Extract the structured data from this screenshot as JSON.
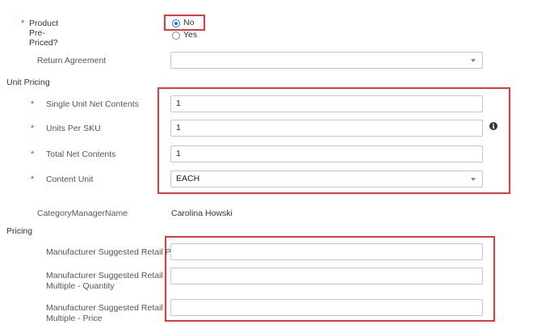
{
  "pre_priced": {
    "label": "Product Pre-Priced?",
    "options": [
      {
        "label": "No",
        "checked": true
      },
      {
        "label": "Yes",
        "checked": false
      }
    ]
  },
  "return_agreement": {
    "label": "Return Agreement",
    "value": ""
  },
  "unit_pricing": {
    "section_title": "Unit Pricing",
    "single_unit_net_contents": {
      "label": "Single Unit Net Contents",
      "value": "1"
    },
    "units_per_sku": {
      "label": "Units Per SKU",
      "value": "1"
    },
    "total_net_contents": {
      "label": "Total Net Contents",
      "value": "1"
    },
    "content_unit": {
      "label": "Content Unit",
      "value": "EACH"
    }
  },
  "category_manager": {
    "label": "CategoryManagerName",
    "value": "Carolina Howski"
  },
  "pricing": {
    "section_title": "Pricing",
    "msrp": {
      "label": "Manufacturer Suggested Retail Price",
      "value": ""
    },
    "msrp_multiple_qty": {
      "label_line1": "Manufacturer Suggested Retail",
      "label_line2": "Multiple - Quantity",
      "value": ""
    },
    "msrp_multiple_price": {
      "label_line1": "Manufacturer Suggested Retail",
      "label_line2": "Multiple - Price",
      "value": ""
    }
  },
  "required_marker": "*",
  "info_glyph": "i",
  "colors": {
    "required": "#e0341d",
    "highlight": "#e0393e",
    "radio_accent": "#1a73e8"
  }
}
